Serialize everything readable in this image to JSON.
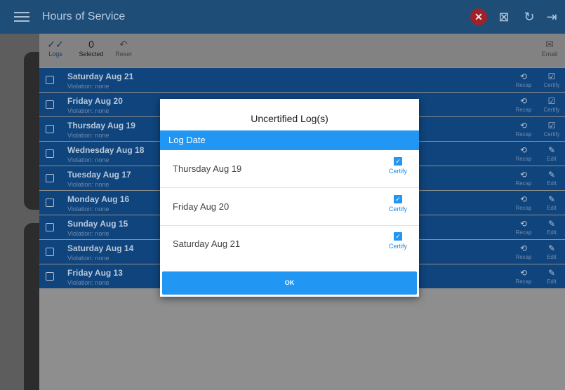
{
  "app": {
    "title": "Hours of Service"
  },
  "toolbar": {
    "logs_label": "Logs",
    "selected_count": "0",
    "selected_label": "Selected",
    "reset_label": "Reset",
    "email_label": "Email"
  },
  "rows": [
    {
      "day": "Saturday Aug 21",
      "violation": "Violation: none",
      "recap": "Recap",
      "action": "Certify"
    },
    {
      "day": "Friday Aug 20",
      "violation": "Violation: none",
      "recap": "Recap",
      "action": "Certify"
    },
    {
      "day": "Thursday Aug 19",
      "violation": "Violation: none",
      "recap": "Recap",
      "action": "Certify"
    },
    {
      "day": "Wednesday Aug 18",
      "violation": "Violation: none",
      "recap": "Recap",
      "action": "Edit"
    },
    {
      "day": "Tuesday Aug 17",
      "violation": "Violation: none",
      "recap": "Recap",
      "action": "Edit"
    },
    {
      "day": "Monday Aug 16",
      "violation": "Violation: none",
      "recap": "Recap",
      "action": "Edit"
    },
    {
      "day": "Sunday Aug 15",
      "violation": "Violation: none",
      "recap": "Recap",
      "action": "Edit"
    },
    {
      "day": "Saturday Aug 14",
      "violation": "Violation: none",
      "recap": "Recap",
      "action": "Edit"
    },
    {
      "day": "Friday Aug 13",
      "violation": "Violation: none",
      "recap": "Recap",
      "action": "Edit"
    }
  ],
  "dialog": {
    "title": "Uncertified Log(s)",
    "header": "Log Date",
    "items": [
      {
        "date": "Thursday Aug 19",
        "action": "Certify"
      },
      {
        "date": "Friday Aug 20",
        "action": "Certify"
      },
      {
        "date": "Saturday Aug 21",
        "action": "Certify"
      }
    ],
    "ok_label": "OK"
  },
  "colors": {
    "appbar": "#1e4d78",
    "row": "#10447d",
    "accent": "#2196f3",
    "error": "#a1212a"
  },
  "icons": [
    "menu-icon",
    "close-circle-icon",
    "unassigned-driving-icon",
    "refresh-icon",
    "logout-icon",
    "double-check-icon",
    "undo-icon",
    "email-icon",
    "history-icon",
    "certify-check-icon",
    "pencil-icon"
  ]
}
